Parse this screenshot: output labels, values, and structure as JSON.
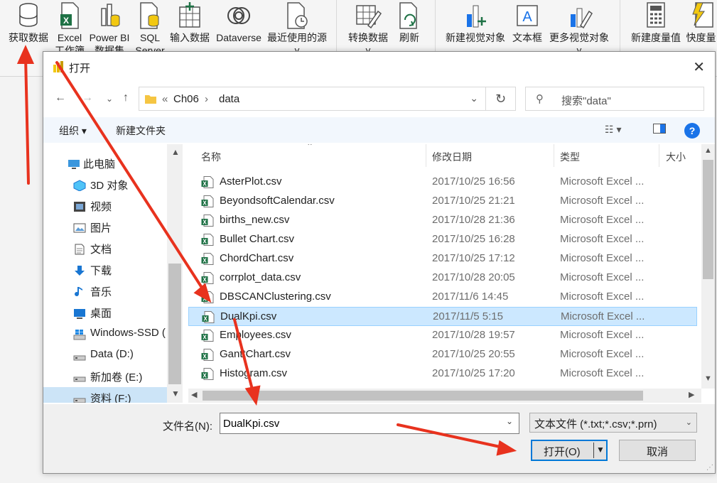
{
  "ribbon": {
    "buttons": [
      {
        "id": "get-data",
        "label": "获取数据",
        "label2": ""
      },
      {
        "id": "excel",
        "label": "Excel",
        "label2": "工作簿"
      },
      {
        "id": "powerbi",
        "label": "Power BI",
        "label2": "数据集"
      },
      {
        "id": "sql",
        "label": "SQL",
        "label2": "Server"
      },
      {
        "id": "input",
        "label": "输入数据",
        "label2": ""
      },
      {
        "id": "dataverse",
        "label": "Dataverse",
        "label2": ""
      },
      {
        "id": "recent",
        "label": "最近使用的源",
        "label2": "˅"
      },
      {
        "id": "transform",
        "label": "转换数据",
        "label2": "˅"
      },
      {
        "id": "refresh",
        "label": "刷新",
        "label2": ""
      },
      {
        "id": "new-visual",
        "label": "新建视觉对象",
        "label2": ""
      },
      {
        "id": "textbox",
        "label": "文本框",
        "label2": ""
      },
      {
        "id": "more-visuals",
        "label": "更多视觉对象",
        "label2": "˅"
      },
      {
        "id": "new-measure",
        "label": "新建度量值",
        "label2": ""
      },
      {
        "id": "quick-measure",
        "label": "快度量",
        "label2": ""
      }
    ]
  },
  "dialog": {
    "title": "打开",
    "address": {
      "prefix": "«",
      "segments": [
        "Ch06",
        "data"
      ]
    },
    "search_placeholder": "搜索\"data\"",
    "toolbar": {
      "organize": "组织",
      "new_folder": "新建文件夹"
    },
    "tree": [
      {
        "label": "此电脑",
        "icon": "computer-icon"
      },
      {
        "label": "3D 对象",
        "icon": "3d-objects-icon"
      },
      {
        "label": "视频",
        "icon": "video-icon"
      },
      {
        "label": "图片",
        "icon": "pictures-icon"
      },
      {
        "label": "文档",
        "icon": "documents-icon"
      },
      {
        "label": "下载",
        "icon": "download-icon"
      },
      {
        "label": "音乐",
        "icon": "music-icon"
      },
      {
        "label": "桌面",
        "icon": "desktop-icon"
      },
      {
        "label": "Windows-SSD (",
        "icon": "windows-drive-icon"
      },
      {
        "label": "Data (D:)",
        "icon": "drive-icon"
      },
      {
        "label": "新加卷 (E:)",
        "icon": "drive-icon"
      },
      {
        "label": "资料 (F:)",
        "icon": "drive-icon"
      }
    ],
    "columns": {
      "name": "名称",
      "modified": "修改日期",
      "type": "类型",
      "size": "大小"
    },
    "files": [
      {
        "name": "AsterPlot.csv",
        "modified": "2017/10/25 16:56",
        "type": "Microsoft Excel ..."
      },
      {
        "name": "BeyondsoftCalendar.csv",
        "modified": "2017/10/25 21:21",
        "type": "Microsoft Excel ..."
      },
      {
        "name": "births_new.csv",
        "modified": "2017/10/28 21:36",
        "type": "Microsoft Excel ..."
      },
      {
        "name": "Bullet Chart.csv",
        "modified": "2017/10/25 16:28",
        "type": "Microsoft Excel ..."
      },
      {
        "name": "ChordChart.csv",
        "modified": "2017/10/25 17:12",
        "type": "Microsoft Excel ..."
      },
      {
        "name": "corrplot_data.csv",
        "modified": "2017/10/28 20:05",
        "type": "Microsoft Excel ..."
      },
      {
        "name": "DBSCANClustering.csv",
        "modified": "2017/11/6 14:45",
        "type": "Microsoft Excel ..."
      },
      {
        "name": "DualKpi.csv",
        "modified": "2017/11/5 5:15",
        "type": "Microsoft Excel ...",
        "selected": true
      },
      {
        "name": "Employees.csv",
        "modified": "2017/10/28 19:57",
        "type": "Microsoft Excel ..."
      },
      {
        "name": "GanttChart.csv",
        "modified": "2017/10/25 20:55",
        "type": "Microsoft Excel ..."
      },
      {
        "name": "Histogram.csv",
        "modified": "2017/10/25 17:20",
        "type": "Microsoft Excel ..."
      }
    ],
    "filename_label": "文件名(N):",
    "filename_value": "DualKpi.csv",
    "filetype_value": "文本文件 (*.txt;*.csv;*.prn)",
    "open_label": "打开(O)",
    "cancel_label": "取消"
  },
  "colors": {
    "accent": "#0078d7",
    "selection": "#cce8ff",
    "annotation": "#e8321e",
    "excel_green": "#1e7145"
  }
}
